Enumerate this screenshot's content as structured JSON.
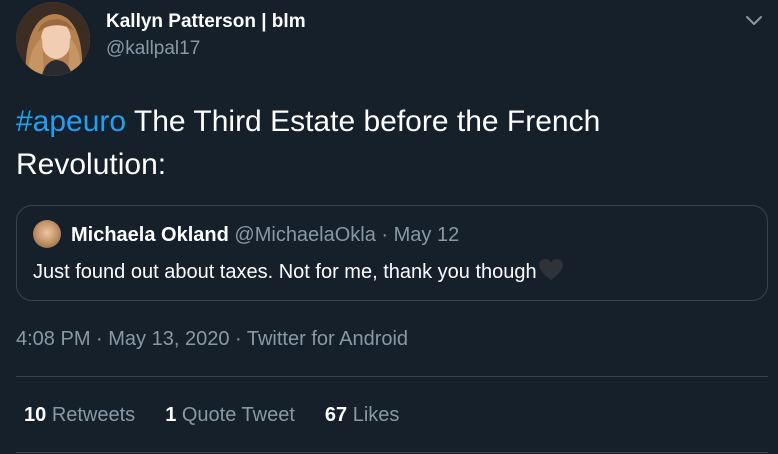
{
  "author": {
    "display_name": "Kallyn Patterson | blm",
    "handle": "@kallpal17"
  },
  "tweet": {
    "hashtag": "#apeuro",
    "text": " The Third Estate before the French Revolution:"
  },
  "quoted_tweet": {
    "name": "Michaela Okland",
    "meta": "@MichaelaOkla · May 12",
    "text": "Just found out about taxes. Not for me, thank you though",
    "emoji": "black-heart-icon"
  },
  "timestamp": "4:08 PM · May 13, 2020 · Twitter for Android",
  "stats": [
    {
      "count": "10",
      "label": "Retweets"
    },
    {
      "count": "1",
      "label": "Quote Tweet"
    },
    {
      "count": "67",
      "label": "Likes"
    }
  ],
  "colors": {
    "background": "#15202b",
    "accent": "#1da1f2",
    "secondary_text": "#8899a6",
    "border": "#38444d"
  }
}
